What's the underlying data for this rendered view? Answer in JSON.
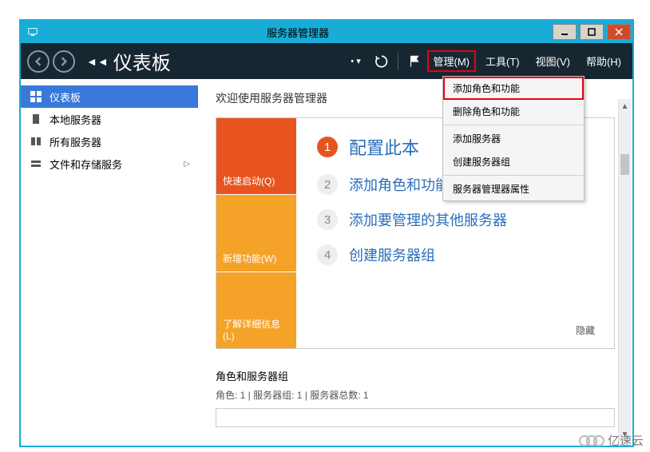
{
  "titlebar": {
    "title": "服务器管理器"
  },
  "toolbar": {
    "breadcrumb": "仪表板",
    "menu": {
      "manage": "管理(M)",
      "tools": "工具(T)",
      "view": "视图(V)",
      "help": "帮助(H)"
    }
  },
  "dropdown": {
    "items": [
      "添加角色和功能",
      "删除角色和功能",
      "添加服务器",
      "创建服务器组",
      "服务器管理器属性"
    ]
  },
  "sidebar": {
    "items": [
      {
        "label": "仪表板"
      },
      {
        "label": "本地服务器"
      },
      {
        "label": "所有服务器"
      },
      {
        "label": "文件和存储服务"
      }
    ]
  },
  "content": {
    "welcome": "欢迎使用服务器管理器",
    "tiles": {
      "quickstart": "快速启动(Q)",
      "new": "新增功能(W)",
      "learn": "了解详细信息(L)"
    },
    "steps": [
      {
        "num": "1",
        "text": "配置此本"
      },
      {
        "num": "2",
        "text": "添加角色和功能"
      },
      {
        "num": "3",
        "text": "添加要管理的其他服务器"
      },
      {
        "num": "4",
        "text": "创建服务器组"
      }
    ],
    "hide": "隐藏",
    "section2_title": "角色和服务器组",
    "section2_sub": "角色: 1 | 服务器组: 1 | 服务器总数: 1"
  },
  "watermark": "亿速云"
}
